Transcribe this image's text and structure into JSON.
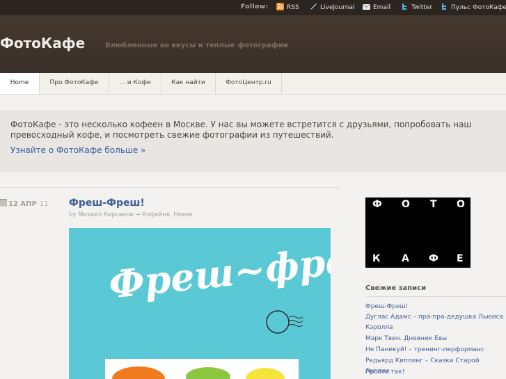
{
  "topbar": {
    "follow_label": "Follow:",
    "links": [
      {
        "label": "RSS",
        "icon": "rss-icon"
      },
      {
        "label": "LiveJournal",
        "icon": "livejournal-icon"
      },
      {
        "label": "Email",
        "icon": "email-icon"
      },
      {
        "label": "Twitter",
        "icon": "twitter-icon"
      },
      {
        "label": "Пульс ФотоКафе",
        "icon": "twitter-icon"
      }
    ]
  },
  "header": {
    "site_title": "ФотоКафе",
    "tagline": "Влюбленные во вкусы и теплые фотографии"
  },
  "nav": {
    "items": [
      "Home",
      "Про ФотоКафе",
      "... и Кофе",
      "Как найти",
      "ФотоЦентр.ru"
    ],
    "active": "Home"
  },
  "intro": {
    "text": "ФотоКафе - это несколько кофеен в Москве. У нас вы можете встретится с друзьями, попробовать наш превосходный кофе, и посмотреть свежие фотографии из путешествий.",
    "link": "Узнайте о ФотоКафе больше »"
  },
  "post": {
    "date_day": "12",
    "date_month": "АПР",
    "date_year": "11",
    "title": "Фреш-Фреш!",
    "meta_by": "by Михаил Кирсанов",
    "meta_arrow": "→",
    "meta_cat1": "Кофейня",
    "meta_sep": ",",
    "meta_cat2": "Новое",
    "image_text": "Фреш~фреш"
  },
  "sidebar": {
    "logo_letters": [
      "Ф",
      "О",
      "Т",
      "О",
      "К",
      "А",
      "Ф",
      "Е"
    ],
    "recent_title": "Свежие записи",
    "recent_posts": [
      "Фреш-Фреш!",
      "Дуглас Адамс – пра-пра-дедушка Льюиса Кэролла",
      "Марк Твен. Дневник Евы",
      "Не Паникуй! – тренинг-перформанс",
      "Редьярд Киплинг – Сказки Старой Англии",
      "Просто так!"
    ]
  },
  "colors": {
    "topbar_bg": "#2b2520",
    "header_bg": "#3e332b",
    "link_blue": "#3e5f9c",
    "image_bg": "#5bc8d6"
  }
}
